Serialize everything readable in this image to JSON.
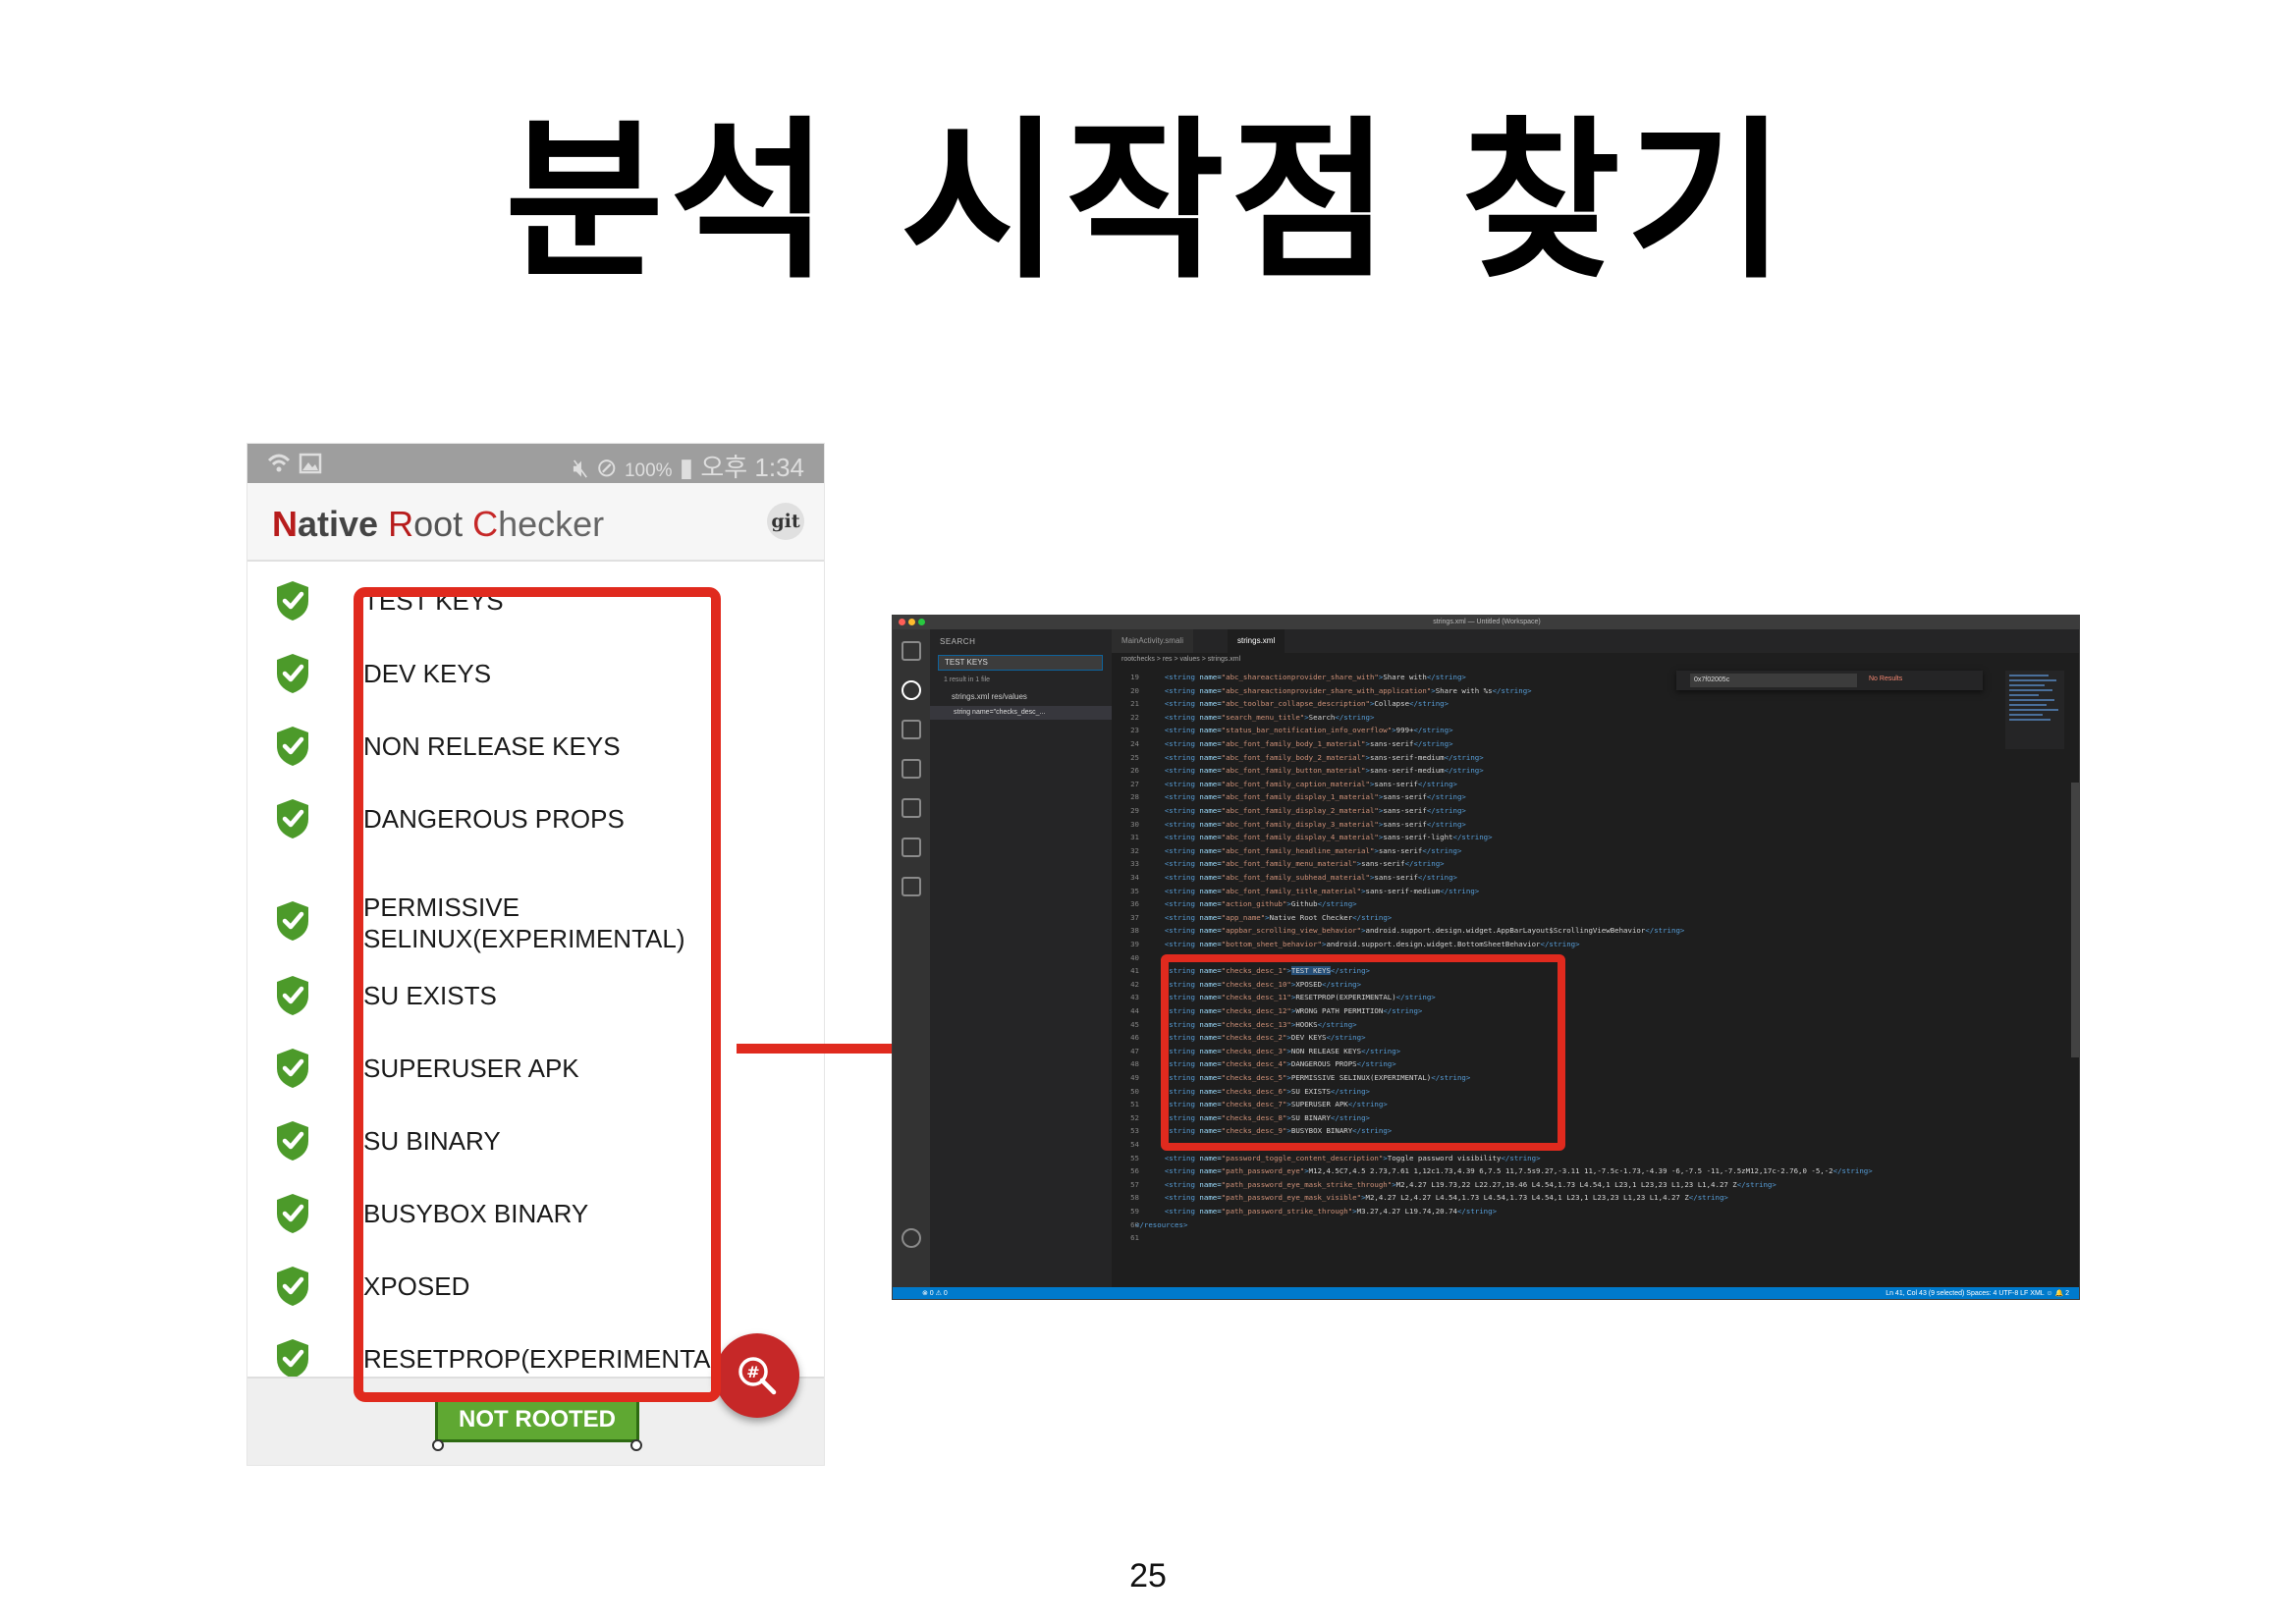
{
  "slide": {
    "title": "분석 시작점 찾기",
    "page_number": "25"
  },
  "phone": {
    "status_bar": {
      "left_icons": "wifi-icon image-icon",
      "battery": "100%",
      "time": "오후 1:34"
    },
    "app_title": {
      "part1_initial": "N",
      "part1_rest": "ative ",
      "part2_initial": "R",
      "part2_rest": "oot ",
      "part3_initial": "C",
      "part3_rest": "hecker"
    },
    "git_label": "git",
    "checks": [
      {
        "label": "TEST KEYS",
        "status": "pass"
      },
      {
        "label": "DEV KEYS",
        "status": "pass"
      },
      {
        "label": "NON RELEASE KEYS",
        "status": "pass"
      },
      {
        "label": "DANGEROUS PROPS",
        "status": "pass"
      },
      {
        "label": "PERMISSIVE\nSELINUX(EXPERIMENTAL)",
        "status": "pass"
      },
      {
        "label": "SU EXISTS",
        "status": "pass"
      },
      {
        "label": "SUPERUSER APK",
        "status": "pass"
      },
      {
        "label": "SU BINARY",
        "status": "pass"
      },
      {
        "label": "BUSYBOX BINARY",
        "status": "pass"
      },
      {
        "label": "XPOSED",
        "status": "pass"
      },
      {
        "label": "RESETPROP(EXPERIMENTAL)",
        "status": "pass"
      }
    ],
    "result_badge": "NOT ROOTED",
    "fab_icon": "search-hash-icon",
    "colors": {
      "brand_red": "#c62828",
      "check_green": "#4c9a2a",
      "badge_green": "#5fa832"
    }
  },
  "editor": {
    "window_title": "strings.xml — Untitled (Workspace)",
    "sidebar": {
      "header": "SEARCH",
      "search_value": "TEST KEYS",
      "result_summary": "1 result in 1 file",
      "file": "strings.xml  res/values",
      "match": "string name=\"checks_desc_..."
    },
    "tabs": [
      {
        "label": "MainActivity.smali",
        "active": false
      },
      {
        "label": "strings.xml",
        "active": true
      }
    ],
    "breadcrumb": "rootchecks > res > values > strings.xml",
    "find_widget": {
      "value": "0x7f02005c",
      "status": "No Results"
    },
    "code_lines": [
      {
        "n": "19",
        "name": "abc_shareactionprovider_share_with",
        "value": "Share with"
      },
      {
        "n": "20",
        "name": "abc_shareactionprovider_share_with_application",
        "value": "Share with %s"
      },
      {
        "n": "21",
        "name": "abc_toolbar_collapse_description",
        "value": "Collapse"
      },
      {
        "n": "22",
        "name": "search_menu_title",
        "value": "Search"
      },
      {
        "n": "23",
        "name": "status_bar_notification_info_overflow",
        "value": "999+"
      },
      {
        "n": "24",
        "name": "abc_font_family_body_1_material",
        "value": "sans-serif"
      },
      {
        "n": "25",
        "name": "abc_font_family_body_2_material",
        "value": "sans-serif-medium"
      },
      {
        "n": "26",
        "name": "abc_font_family_button_material",
        "value": "sans-serif-medium"
      },
      {
        "n": "27",
        "name": "abc_font_family_caption_material",
        "value": "sans-serif"
      },
      {
        "n": "28",
        "name": "abc_font_family_display_1_material",
        "value": "sans-serif"
      },
      {
        "n": "29",
        "name": "abc_font_family_display_2_material",
        "value": "sans-serif"
      },
      {
        "n": "30",
        "name": "abc_font_family_display_3_material",
        "value": "sans-serif"
      },
      {
        "n": "31",
        "name": "abc_font_family_display_4_material",
        "value": "sans-serif-light"
      },
      {
        "n": "32",
        "name": "abc_font_family_headline_material",
        "value": "sans-serif"
      },
      {
        "n": "33",
        "name": "abc_font_family_menu_material",
        "value": "sans-serif"
      },
      {
        "n": "34",
        "name": "abc_font_family_subhead_material",
        "value": "sans-serif"
      },
      {
        "n": "35",
        "name": "abc_font_family_title_material",
        "value": "sans-serif-medium"
      },
      {
        "n": "36",
        "name": "action_github",
        "value": "Github"
      },
      {
        "n": "37",
        "name": "app_name",
        "value": "Native Root Checker"
      },
      {
        "n": "38",
        "name": "appbar_scrolling_view_behavior",
        "value": "android.support.design.widget.AppBarLayout$ScrollingViewBehavior"
      },
      {
        "n": "39",
        "name": "bottom_sheet_behavior",
        "value": "android.support.design.widget.BottomSheetBehavior"
      },
      {
        "n": "40",
        "name": "",
        "value": ""
      },
      {
        "n": "41",
        "name": "checks_desc_1",
        "value": "TEST KEYS",
        "highlight": true
      },
      {
        "n": "42",
        "name": "checks_desc_10",
        "value": "XPOSED"
      },
      {
        "n": "43",
        "name": "checks_desc_11",
        "value": "RESETPROP(EXPERIMENTAL)"
      },
      {
        "n": "44",
        "name": "checks_desc_12",
        "value": "WRONG PATH PERMITION"
      },
      {
        "n": "45",
        "name": "checks_desc_13",
        "value": "HOOKS"
      },
      {
        "n": "46",
        "name": "checks_desc_2",
        "value": "DEV KEYS"
      },
      {
        "n": "47",
        "name": "checks_desc_3",
        "value": "NON RELEASE KEYS"
      },
      {
        "n": "48",
        "name": "checks_desc_4",
        "value": "DANGEROUS PROPS"
      },
      {
        "n": "49",
        "name": "checks_desc_5",
        "value": "PERMISSIVE SELINUX(EXPERIMENTAL)"
      },
      {
        "n": "50",
        "name": "checks_desc_6",
        "value": "SU EXISTS"
      },
      {
        "n": "51",
        "name": "checks_desc_7",
        "value": "SUPERUSER APK"
      },
      {
        "n": "52",
        "name": "checks_desc_8",
        "value": "SU BINARY"
      },
      {
        "n": "53",
        "name": "checks_desc_9",
        "value": "BUSYBOX BINARY"
      },
      {
        "n": "54",
        "name": "",
        "value": ""
      },
      {
        "n": "55",
        "name": "password_toggle_content_description",
        "value": "Toggle password visibility"
      },
      {
        "n": "56",
        "name": "path_password_eye",
        "value": "M12,4.5C7,4.5 2.73,7.61 1,12c1.73,4.39 6,7.5 11,7.5s9.27,-3.11 11,-7.5c-1.73,-4.39 -6,-7.5 -11,-7.5zM12,17c-2.76,0 -5,-2"
      },
      {
        "n": "57",
        "name": "path_password_eye_mask_strike_through",
        "value": "M2,4.27 L19.73,22 L22.27,19.46 L4.54,1.73 L4.54,1 L23,1 L23,23 L1,23 L1,4.27 Z"
      },
      {
        "n": "58",
        "name": "path_password_eye_mask_visible",
        "value": "M2,4.27 L2,4.27 L4.54,1.73 L4.54,1.73 L4.54,1 L23,1 L23,23 L1,23 L1,4.27 Z"
      },
      {
        "n": "59",
        "name": "path_password_strike_through",
        "value": "M3.27,4.27 L19.74,20.74"
      },
      {
        "n": "60",
        "name": "__close__",
        "value": ""
      },
      {
        "n": "61",
        "name": "",
        "value": ""
      }
    ],
    "status_bar": {
      "left": "⊗ 0 ⚠ 0",
      "right": "Ln 41, Col 43 (9 selected)    Spaces: 4    UTF-8    LF    XML    ☺    🔔 2"
    },
    "colors": {
      "background": "#1e1e1e",
      "status_blue": "#007acc",
      "tag": "#569cd6",
      "attr": "#9cdcfe",
      "string": "#ce9178"
    }
  },
  "annotations": {
    "highlight_color": "#e02a1e"
  }
}
